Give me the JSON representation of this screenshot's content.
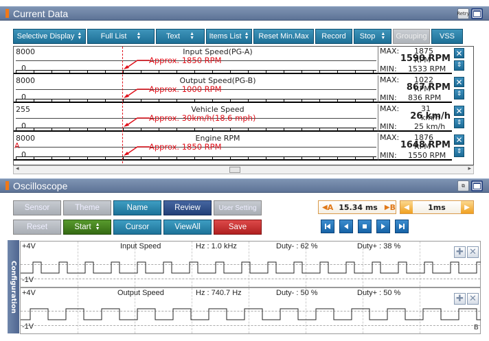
{
  "current_data": {
    "title": "Current Data",
    "retry_label": "Retry",
    "buttons": [
      "Selective Display",
      "Full List",
      "Text",
      "Items List",
      "Reset Min.Max",
      "Record",
      "Stop",
      "Grouping",
      "VSS"
    ],
    "rows": [
      {
        "top": "8000",
        "zero": "0",
        "name": "Input Speed(PG-A)",
        "approx": "Approx. 1850 RPM",
        "max_label": "MAX:",
        "max": "1875 RPM",
        "current": "1590 RPM",
        "min_label": "MIN:",
        "min": "1533 RPM"
      },
      {
        "top": "8000",
        "zero": "0",
        "name": "Output Speed(PG-B)",
        "approx": "Approx. 1000 RPM",
        "max_label": "MAX:",
        "max": "1022 RPM",
        "current": "867 RPM",
        "min_label": "MIN:",
        "min": "836 RPM"
      },
      {
        "top": "255",
        "zero": "0",
        "name": "Vehicle Speed",
        "approx": "Approx. 30km/h(18.6 mph)",
        "max_label": "MAX:",
        "max": "31 km/h",
        "current": "26 km/h",
        "min_label": "MIN:",
        "min": "25 km/h"
      },
      {
        "top": "8000",
        "zero": "0",
        "name": "Engine RPM",
        "approx": "Approx. 1850 RPM",
        "marker": "A",
        "max_label": "MAX:",
        "max": "1876 RPM",
        "current": "1648 RPM",
        "min_label": "MIN:",
        "min": "1550 RPM"
      }
    ]
  },
  "oscilloscope": {
    "title": "Oscilloscope",
    "row1": [
      "Sensor",
      "Theme",
      "Name",
      "Review",
      "User Setting"
    ],
    "row2": [
      "Reset",
      "Start",
      "Cursor",
      "ViewAll",
      "Save"
    ],
    "time_a": "A",
    "time_value": "15.34 ms",
    "time_b": "B",
    "timebase": "1ms",
    "side_tab": "Configuration",
    "channels": [
      {
        "vmax": "+4V",
        "vmin": "-1V",
        "name": "Input Speed",
        "hz": "Hz : 1.0 kHz",
        "duty_minus": "Duty- : 62 %",
        "duty_plus": "Duty+ : 38 %"
      },
      {
        "vmax": "+4V",
        "vmin": "-1V",
        "name": "Output Speed",
        "hz": "Hz : 740.7 Hz",
        "duty_minus": "Duty- : 50 %",
        "duty_plus": "Duty+ : 50 %",
        "marker": "B"
      }
    ]
  },
  "colors": {
    "accent": "#1d6f96",
    "title_bar": "#5d7396",
    "annotation": "#e0101a",
    "orange": "#f07818"
  }
}
